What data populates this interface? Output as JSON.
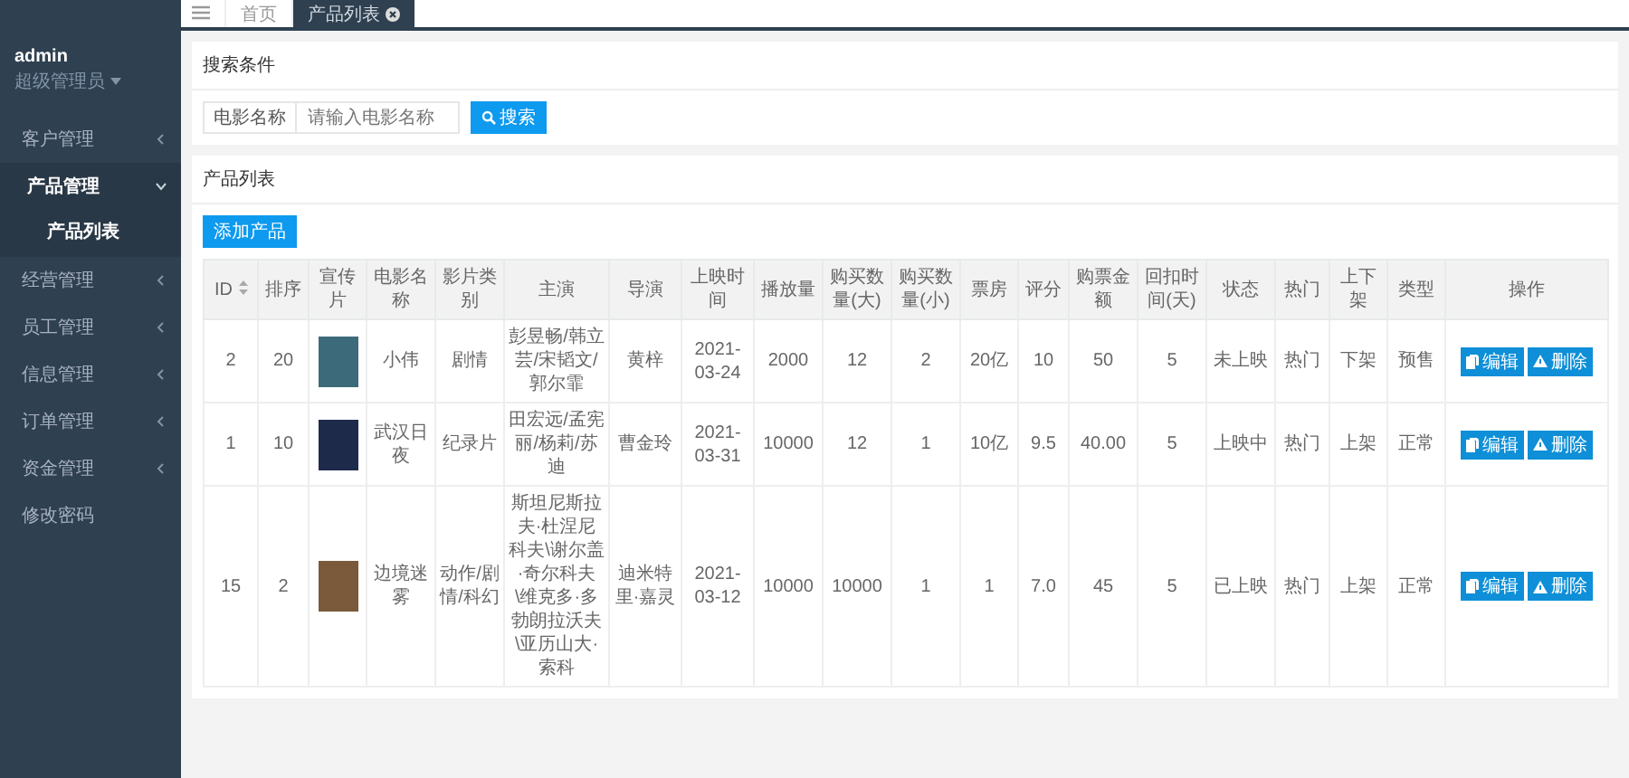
{
  "sidebar": {
    "user": {
      "name": "admin",
      "role": "超级管理员"
    },
    "items": [
      {
        "label": "客户管理",
        "kind": "group",
        "expanded": false
      },
      {
        "label": "产品管理",
        "kind": "group",
        "expanded": true,
        "children": [
          {
            "label": "产品列表",
            "selected": true
          }
        ]
      },
      {
        "label": "经营管理",
        "kind": "group",
        "expanded": false
      },
      {
        "label": "员工管理",
        "kind": "group",
        "expanded": false
      },
      {
        "label": "信息管理",
        "kind": "group",
        "expanded": false
      },
      {
        "label": "订单管理",
        "kind": "group",
        "expanded": false
      },
      {
        "label": "资金管理",
        "kind": "group",
        "expanded": false
      },
      {
        "label": "修改密码",
        "kind": "link",
        "expanded": false
      }
    ]
  },
  "tabs": [
    {
      "label": "首页",
      "selected": false,
      "closable": false
    },
    {
      "label": "产品列表",
      "selected": true,
      "closable": true
    }
  ],
  "search_panel": {
    "title": "搜索条件",
    "field_label": "电影名称",
    "placeholder": "请输入电影名称",
    "button": "搜索"
  },
  "list_panel": {
    "title": "产品列表",
    "add_button": "添加产品"
  },
  "table": {
    "columns": [
      {
        "label": "ID",
        "sortable": true
      },
      {
        "label": "排序",
        "sortable": false
      },
      {
        "label": "宣传片",
        "sortable": false
      },
      {
        "label": "电影名称",
        "sortable": false
      },
      {
        "label": "影片类别",
        "sortable": false
      },
      {
        "label": "主演",
        "sortable": false
      },
      {
        "label": "导演",
        "sortable": false
      },
      {
        "label": "上映时间",
        "sortable": false
      },
      {
        "label": "播放量",
        "sortable": false
      },
      {
        "label": "购买数量(大)",
        "sortable": false
      },
      {
        "label": "购买数量(小)",
        "sortable": false
      },
      {
        "label": "票房",
        "sortable": false
      },
      {
        "label": "评分",
        "sortable": false
      },
      {
        "label": "购票金额",
        "sortable": false
      },
      {
        "label": "回扣时间(天)",
        "sortable": false
      },
      {
        "label": "状态",
        "sortable": false
      },
      {
        "label": "热门",
        "sortable": false
      },
      {
        "label": "上下架",
        "sortable": false
      },
      {
        "label": "类型",
        "sortable": false
      },
      {
        "label": "操作",
        "sortable": false
      }
    ],
    "rows": [
      {
        "cells": [
          "2",
          "20",
          null,
          "小伟",
          "剧情",
          "彭昱畅/韩立芸/宋韬文/郭尔霏",
          "黄梓",
          "2021-03-24",
          "2000",
          "12",
          "2",
          "20亿",
          "10",
          "50",
          "5",
          "未上映",
          "热门",
          "下架",
          "预售"
        ],
        "actions": [
          "编辑",
          "删除"
        ]
      },
      {
        "cells": [
          "1",
          "10",
          null,
          "武汉日夜",
          "纪录片",
          "田宏远/孟宪丽/杨莉/苏迪",
          "曹金玲",
          "2021-03-31",
          "10000",
          "12",
          "1",
          "10亿",
          "9.5",
          "40.00",
          "5",
          "上映中",
          "热门",
          "上架",
          "正常"
        ],
        "actions": [
          "编辑",
          "删除"
        ]
      },
      {
        "cells": [
          "15",
          "2",
          null,
          "边境迷雾",
          "动作/剧情/科幻",
          "斯坦尼斯拉夫·杜涅尼科夫\\谢尔盖·奇尔科夫\\维克多·多勃朗拉沃夫\\亚历山大·索科",
          "迪米特里·嘉灵",
          "2021-03-12",
          "10000",
          "10000",
          "1",
          "1",
          "7.0",
          "45",
          "5",
          "已上映",
          "热门",
          "上架",
          "正常"
        ],
        "actions": [
          "编辑",
          "删除"
        ]
      }
    ]
  }
}
